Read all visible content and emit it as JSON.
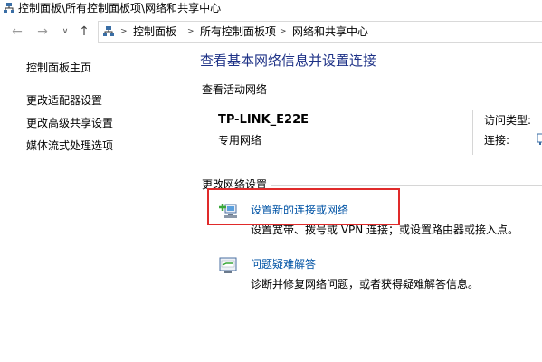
{
  "window": {
    "title": "控制面板\\所有控制面板项\\网络和共享中心",
    "icon": "network-icon"
  },
  "address_bar": {
    "crumbs": [
      "控制面板",
      "所有控制面板项",
      "网络和共享中心"
    ]
  },
  "sidebar": {
    "items": [
      {
        "label": "控制面板主页"
      },
      {
        "label": "更改适配器设置"
      },
      {
        "label": "更改高级共享设置"
      },
      {
        "label": "媒体流式处理选项"
      }
    ]
  },
  "main": {
    "title": "查看基本网络信息并设置连接",
    "active_networks": {
      "heading": "查看活动网络",
      "network_name": "TP-LINK_E22E",
      "network_type": "专用网络",
      "access_type_label": "访问类型:",
      "connection_label": "连接:"
    },
    "change_settings": {
      "heading": "更改网络设置",
      "tasks": [
        {
          "label": "设置新的连接或网络",
          "desc": "设置宽带、拨号或 VPN 连接；或设置路由器或接入点。",
          "icon": "new-connection-icon"
        },
        {
          "label": "问题疑难解答",
          "desc": "诊断并修复网络问题，或者获得疑难解答信息。",
          "icon": "troubleshoot-icon"
        }
      ]
    }
  },
  "colors": {
    "title_blue": "#1e3287",
    "link_blue": "#0053a5",
    "highlight_red": "#e02a2a"
  }
}
